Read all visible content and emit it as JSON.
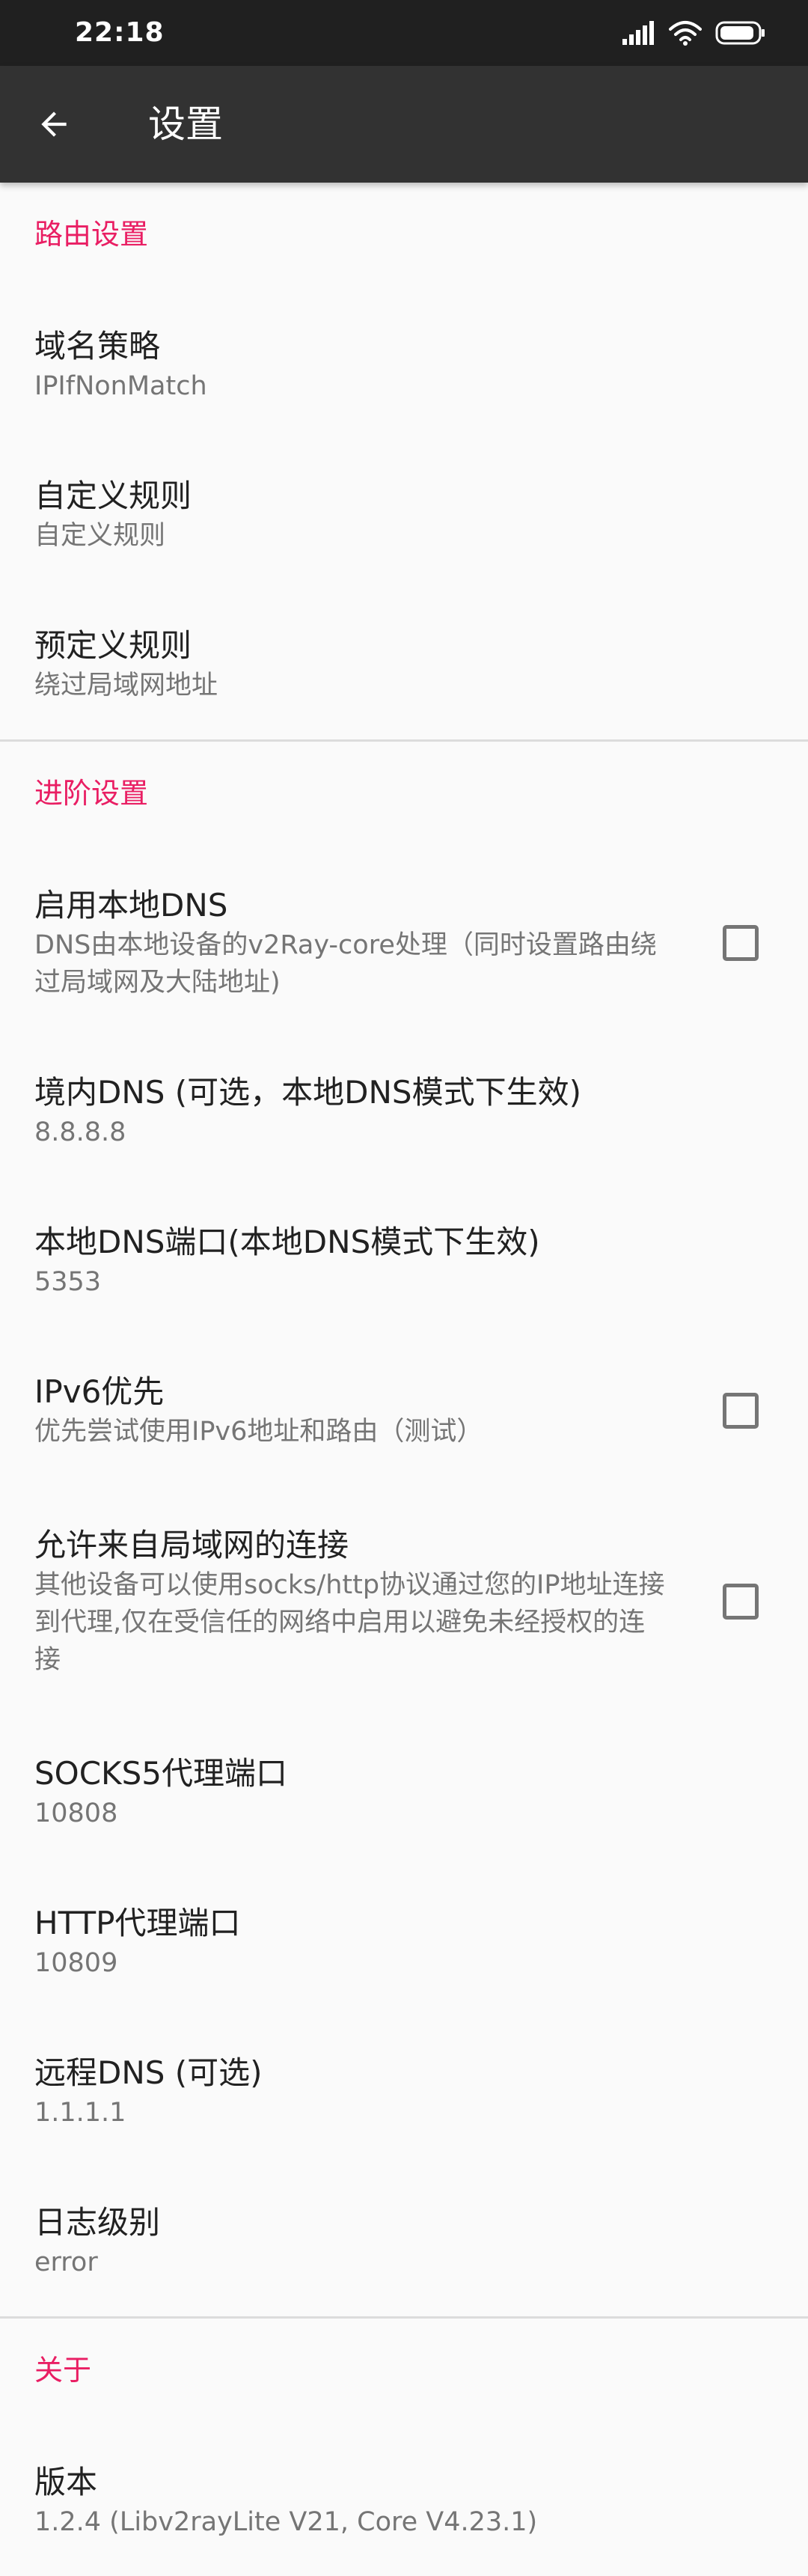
{
  "status_bar": {
    "time": "22:18"
  },
  "app_bar": {
    "title": "设置"
  },
  "sections": {
    "routing": {
      "header": "路由设置",
      "domain_strategy": {
        "title": "域名策略",
        "summary": "IPIfNonMatch"
      },
      "custom_rules": {
        "title": "自定义规则",
        "summary": "自定义规则"
      },
      "predefined_rules": {
        "title": "预定义规则",
        "summary": "绕过局域网地址"
      }
    },
    "advanced": {
      "header": "进阶设置",
      "local_dns": {
        "title": "启用本地DNS",
        "summary": "DNS由本地设备的v2Ray-core处理（同时设置路由绕过局域网及大陆地址)",
        "checked": false
      },
      "domestic_dns": {
        "title": "境内DNS (可选，本地DNS模式下生效)",
        "summary": "8.8.8.8"
      },
      "local_dns_port": {
        "title": "本地DNS端口(本地DNS模式下生效)",
        "summary": "5353"
      },
      "ipv6_first": {
        "title": "IPv6优先",
        "summary": "优先尝试使用IPv6地址和路由（测试）",
        "checked": false
      },
      "allow_lan": {
        "title": "允许来自局域网的连接",
        "summary": "其他设备可以使用socks/http协议通过您的IP地址连接到代理,仅在受信任的网络中启用以避免未经授权的连接",
        "checked": false
      },
      "socks5_port": {
        "title": "SOCKS5代理端口",
        "summary": "10808"
      },
      "http_port": {
        "title": "HTTP代理端口",
        "summary": "10809"
      },
      "remote_dns": {
        "title": "远程DNS (可选)",
        "summary": "1.1.1.1"
      },
      "log_level": {
        "title": "日志级别",
        "summary": "error"
      }
    },
    "about": {
      "header": "关于",
      "version": {
        "title": "版本",
        "summary": "1.2.4 (Libv2rayLite V21, Core V4.23.1)"
      }
    }
  },
  "colors": {
    "accent": "#e91e63",
    "status_bar_bg": "#202020",
    "app_bar_bg": "#323232",
    "background": "#fafafa",
    "title_text": "#212121",
    "summary_text": "#757575",
    "divider": "#dcdcdc"
  },
  "icons": {
    "back": "arrow-left-icon",
    "signal": "cellular-signal-icon",
    "wifi": "wifi-icon",
    "battery": "battery-icon"
  }
}
